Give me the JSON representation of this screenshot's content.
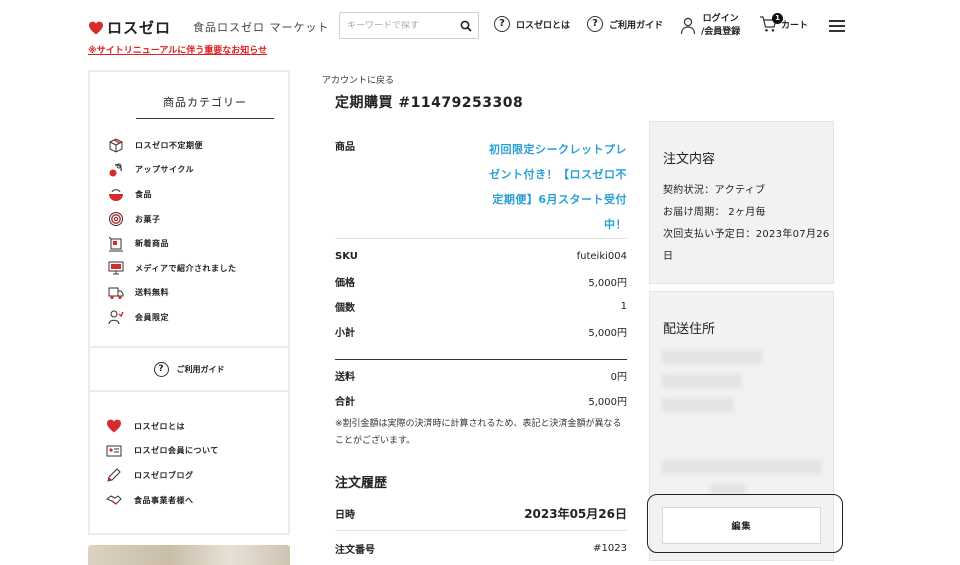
{
  "header": {
    "logo_text": "ロスゼロ",
    "tagline": "食品ロスゼロ マーケット",
    "search_placeholder": "キーワードで探す",
    "nav_about": "ロスゼロとは",
    "nav_guide": "ご利用ガイド",
    "nav_login_line1": "ログイン",
    "nav_login_line2": "/会員登録",
    "nav_cart": "カート",
    "cart_count": "1",
    "notice": "※サイトリニューアルに伴う重要なお知らせ"
  },
  "sidebar": {
    "category_title": "商品カテゴリー",
    "categories": [
      {
        "label": "ロスゼロ不定期便",
        "icon": "box-icon"
      },
      {
        "label": "アップサイクル",
        "icon": "upcycle-icon"
      },
      {
        "label": "食品",
        "icon": "food-bowl-icon"
      },
      {
        "label": "お菓子",
        "icon": "donut-icon"
      },
      {
        "label": "新着商品",
        "icon": "new-arrival-icon"
      },
      {
        "label": "メディアで紹介されました",
        "icon": "monitor-icon"
      },
      {
        "label": "送料無料",
        "icon": "truck-icon"
      },
      {
        "label": "会員限定",
        "icon": "member-icon"
      }
    ],
    "guide_label": "ご利用ガイド",
    "about_items": [
      {
        "label": "ロスゼロとは",
        "icon": "heart-icon"
      },
      {
        "label": "ロスゼロ会員について",
        "icon": "id-card-icon"
      },
      {
        "label": "ロスゼロブログ",
        "icon": "pencil-icon"
      },
      {
        "label": "食品事業者様へ",
        "icon": "handshake-icon"
      }
    ]
  },
  "main": {
    "back_link": "アカウントに戻る",
    "title": "定期購買 #11479253308",
    "product_label": "商品",
    "product_name": "初回限定シークレットプレゼント付き！【ロスゼロ不定期便】6月スタート受付中！",
    "sku_label": "SKU",
    "sku_value": "futeiki004",
    "price_label": "価格",
    "price_value": "5,000円",
    "qty_label": "個数",
    "qty_value": "1",
    "subtotal_label": "小計",
    "subtotal_value": "5,000円",
    "shipping_label": "送料",
    "shipping_value": "0円",
    "total_label": "合計",
    "total_value": "5,000円",
    "note": "※割引金額は実際の決済時に計算されるため、表記と決済金額が異なることがございます。",
    "history_title": "注文履歴",
    "date_label": "日時",
    "date_value": "2023年05月26日",
    "order_no_label": "注文番号",
    "order_no_value": "#1023"
  },
  "panel": {
    "order_title": "注文内容",
    "status_line": "契約状況：アクティブ",
    "cycle_line": "お届け周期： 2ヶ月毎",
    "next_payment_line": "次回支払い予定日：2023年07月26日",
    "address_title": "配送住所",
    "edit_label": "編集"
  },
  "colors": {
    "brand_red": "#d82a2a",
    "link_blue": "#2a9fd6",
    "panel_bg": "#f2f2f2"
  }
}
